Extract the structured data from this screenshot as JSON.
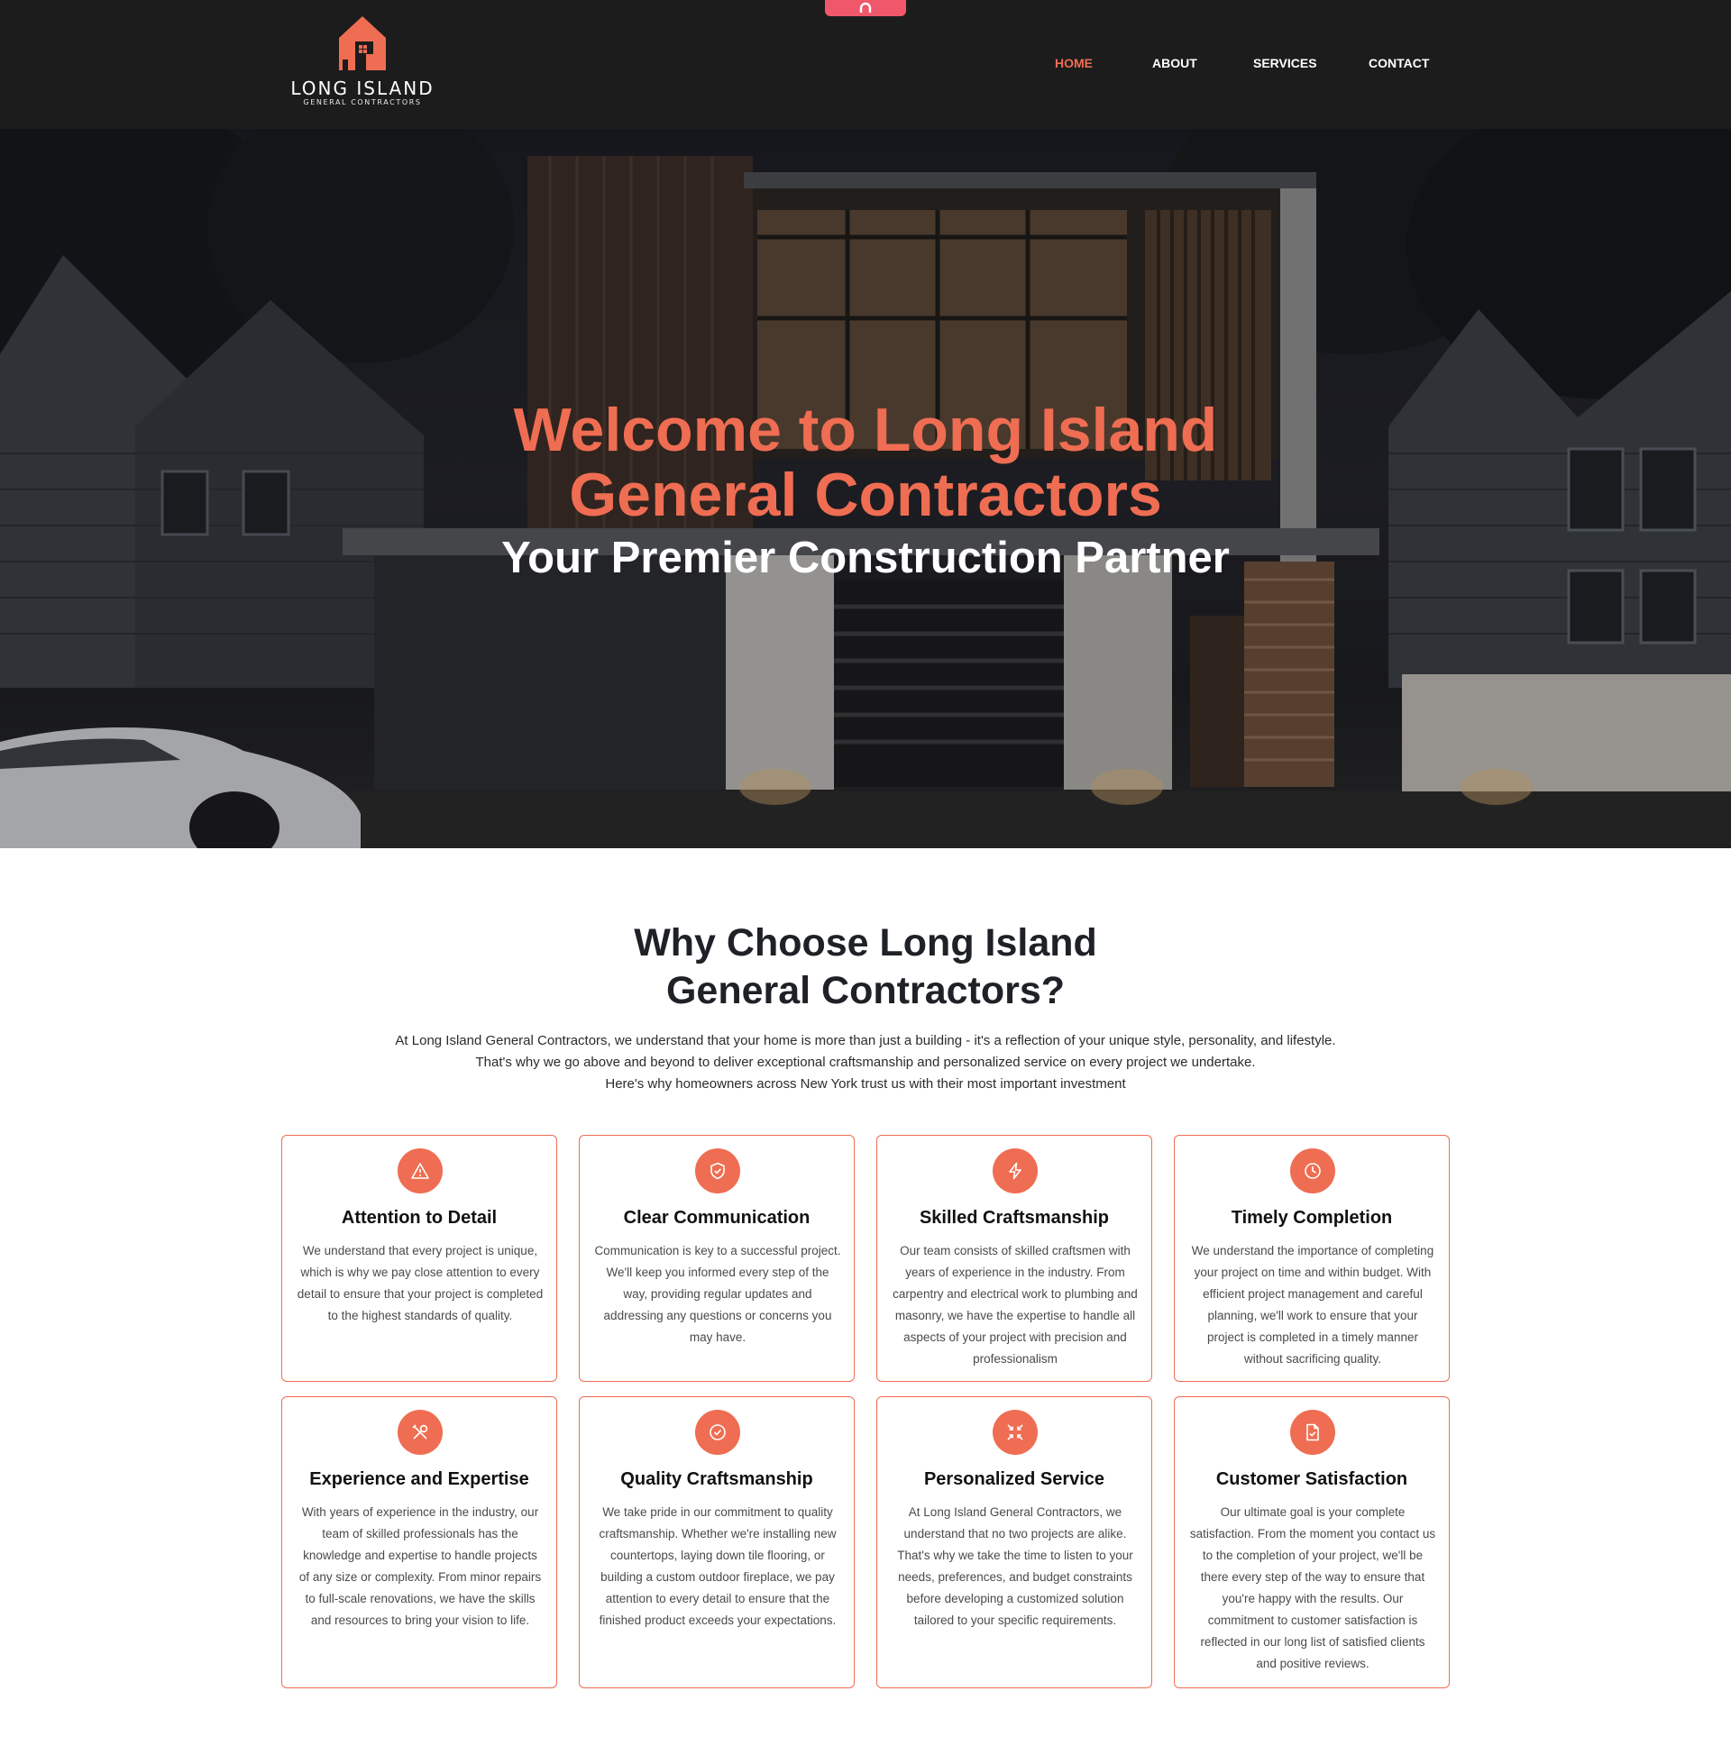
{
  "brand": {
    "name_line1": "LONG ISLAND",
    "name_line2": "GENERAL CONTRACTORS"
  },
  "nav": {
    "items": [
      {
        "label": "HOME",
        "active": true
      },
      {
        "label": "ABOUT",
        "active": false
      },
      {
        "label": "SERVICES",
        "active": false
      },
      {
        "label": "CONTACT",
        "active": false
      }
    ]
  },
  "hero": {
    "title_line1": "Welcome to Long Island",
    "title_line2": "General Contractors",
    "subtitle": "Your Premier Construction Partner"
  },
  "why": {
    "title_line1": "Why Choose Long Island",
    "title_line2": "General Contractors?",
    "intro_line1": "At Long Island General Contractors, we understand that your home is more than just a building - it's a reflection of your unique style, personality, and lifestyle.",
    "intro_line2": "That's why we go above and beyond to deliver exceptional craftsmanship and personalized service on every project we undertake.",
    "intro_line3": "Here's why homeowners across New York trust us with their most important investment",
    "cards": [
      {
        "icon": "warning-triangle-icon",
        "title": "Attention to Detail",
        "text": "We understand that every project is unique, which is why we pay close attention to every detail to ensure that your project is completed to the highest standards of quality."
      },
      {
        "icon": "shield-check-icon",
        "title": "Clear Communication",
        "text": "Communication is key to a successful project. We'll keep you informed every step of the way, providing regular updates and addressing any questions or concerns you may have."
      },
      {
        "icon": "lightning-bolt-icon",
        "title": "Skilled Craftsmanship",
        "text": "Our team consists of skilled craftsmen with years of experience in the industry. From carpentry and electrical work to plumbing and masonry, we have the expertise to handle all aspects of your project with precision and professionalism"
      },
      {
        "icon": "clock-icon",
        "title": "Timely Completion",
        "text": "We understand the importance of completing your project on time and within budget. With efficient project management and careful planning, we'll work to ensure that your project is completed in a timely manner without sacrificing quality."
      },
      {
        "icon": "tools-icon",
        "title": "Experience and Expertise",
        "text": "With years of experience in the industry, our team of skilled professionals has the knowledge and expertise to handle projects of any size or complexity. From minor repairs to full-scale renovations, we have the skills and resources to bring your vision to life."
      },
      {
        "icon": "check-circle-icon",
        "title": "Quality Craftsmanship",
        "text": "We take pride in our commitment to quality craftsmanship. Whether we're installing new countertops, laying down tile flooring, or building a custom outdoor fireplace, we pay attention to every detail to ensure that the finished product exceeds your expectations."
      },
      {
        "icon": "arrows-inward-icon",
        "title": "Personalized Service",
        "text": "At Long Island General Contractors, we understand that no two projects are alike. That's why we take the time to listen to your needs, preferences, and budget constraints before developing a customized solution tailored to your specific requirements."
      },
      {
        "icon": "document-check-icon",
        "title": "Customer Satisfaction",
        "text": "Our ultimate goal is your complete satisfaction. From the moment you contact us to the completion of your project, we'll be there every step of the way to ensure that you're happy with the results. Our commitment to customer satisfaction is reflected in our long list of satisfied clients and positive reviews."
      }
    ]
  },
  "colors": {
    "accent": "#ef6d52",
    "header_bg": "#1c1c1c",
    "tab": "#f0576a"
  }
}
